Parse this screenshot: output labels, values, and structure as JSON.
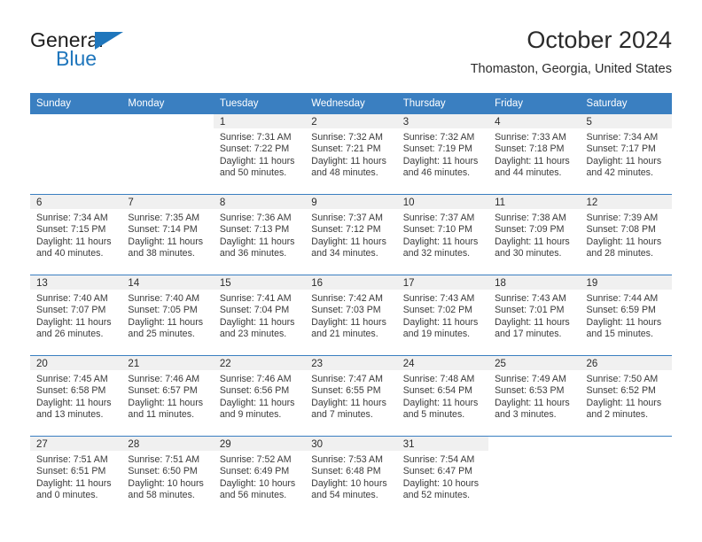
{
  "brand": {
    "name_part1": "General",
    "name_part2": "Blue",
    "accent_color": "#1f76bc"
  },
  "header": {
    "month_title": "October 2024",
    "location": "Thomaston, Georgia, United States"
  },
  "calendar": {
    "header_color": "#3a7fc1",
    "weekday_headers": [
      "Sunday",
      "Monday",
      "Tuesday",
      "Wednesday",
      "Thursday",
      "Friday",
      "Saturday"
    ],
    "weeks": [
      [
        {
          "day": "",
          "blank": true,
          "sunrise": "",
          "sunset": "",
          "daylight1": "",
          "daylight2": ""
        },
        {
          "day": "",
          "blank": true,
          "sunrise": "",
          "sunset": "",
          "daylight1": "",
          "daylight2": ""
        },
        {
          "day": "1",
          "sunrise": "Sunrise: 7:31 AM",
          "sunset": "Sunset: 7:22 PM",
          "daylight1": "Daylight: 11 hours",
          "daylight2": "and 50 minutes."
        },
        {
          "day": "2",
          "sunrise": "Sunrise: 7:32 AM",
          "sunset": "Sunset: 7:21 PM",
          "daylight1": "Daylight: 11 hours",
          "daylight2": "and 48 minutes."
        },
        {
          "day": "3",
          "sunrise": "Sunrise: 7:32 AM",
          "sunset": "Sunset: 7:19 PM",
          "daylight1": "Daylight: 11 hours",
          "daylight2": "and 46 minutes."
        },
        {
          "day": "4",
          "sunrise": "Sunrise: 7:33 AM",
          "sunset": "Sunset: 7:18 PM",
          "daylight1": "Daylight: 11 hours",
          "daylight2": "and 44 minutes."
        },
        {
          "day": "5",
          "sunrise": "Sunrise: 7:34 AM",
          "sunset": "Sunset: 7:17 PM",
          "daylight1": "Daylight: 11 hours",
          "daylight2": "and 42 minutes."
        }
      ],
      [
        {
          "day": "6",
          "sunrise": "Sunrise: 7:34 AM",
          "sunset": "Sunset: 7:15 PM",
          "daylight1": "Daylight: 11 hours",
          "daylight2": "and 40 minutes."
        },
        {
          "day": "7",
          "sunrise": "Sunrise: 7:35 AM",
          "sunset": "Sunset: 7:14 PM",
          "daylight1": "Daylight: 11 hours",
          "daylight2": "and 38 minutes."
        },
        {
          "day": "8",
          "sunrise": "Sunrise: 7:36 AM",
          "sunset": "Sunset: 7:13 PM",
          "daylight1": "Daylight: 11 hours",
          "daylight2": "and 36 minutes."
        },
        {
          "day": "9",
          "sunrise": "Sunrise: 7:37 AM",
          "sunset": "Sunset: 7:12 PM",
          "daylight1": "Daylight: 11 hours",
          "daylight2": "and 34 minutes."
        },
        {
          "day": "10",
          "sunrise": "Sunrise: 7:37 AM",
          "sunset": "Sunset: 7:10 PM",
          "daylight1": "Daylight: 11 hours",
          "daylight2": "and 32 minutes."
        },
        {
          "day": "11",
          "sunrise": "Sunrise: 7:38 AM",
          "sunset": "Sunset: 7:09 PM",
          "daylight1": "Daylight: 11 hours",
          "daylight2": "and 30 minutes."
        },
        {
          "day": "12",
          "sunrise": "Sunrise: 7:39 AM",
          "sunset": "Sunset: 7:08 PM",
          "daylight1": "Daylight: 11 hours",
          "daylight2": "and 28 minutes."
        }
      ],
      [
        {
          "day": "13",
          "sunrise": "Sunrise: 7:40 AM",
          "sunset": "Sunset: 7:07 PM",
          "daylight1": "Daylight: 11 hours",
          "daylight2": "and 26 minutes."
        },
        {
          "day": "14",
          "sunrise": "Sunrise: 7:40 AM",
          "sunset": "Sunset: 7:05 PM",
          "daylight1": "Daylight: 11 hours",
          "daylight2": "and 25 minutes."
        },
        {
          "day": "15",
          "sunrise": "Sunrise: 7:41 AM",
          "sunset": "Sunset: 7:04 PM",
          "daylight1": "Daylight: 11 hours",
          "daylight2": "and 23 minutes."
        },
        {
          "day": "16",
          "sunrise": "Sunrise: 7:42 AM",
          "sunset": "Sunset: 7:03 PM",
          "daylight1": "Daylight: 11 hours",
          "daylight2": "and 21 minutes."
        },
        {
          "day": "17",
          "sunrise": "Sunrise: 7:43 AM",
          "sunset": "Sunset: 7:02 PM",
          "daylight1": "Daylight: 11 hours",
          "daylight2": "and 19 minutes."
        },
        {
          "day": "18",
          "sunrise": "Sunrise: 7:43 AM",
          "sunset": "Sunset: 7:01 PM",
          "daylight1": "Daylight: 11 hours",
          "daylight2": "and 17 minutes."
        },
        {
          "day": "19",
          "sunrise": "Sunrise: 7:44 AM",
          "sunset": "Sunset: 6:59 PM",
          "daylight1": "Daylight: 11 hours",
          "daylight2": "and 15 minutes."
        }
      ],
      [
        {
          "day": "20",
          "sunrise": "Sunrise: 7:45 AM",
          "sunset": "Sunset: 6:58 PM",
          "daylight1": "Daylight: 11 hours",
          "daylight2": "and 13 minutes."
        },
        {
          "day": "21",
          "sunrise": "Sunrise: 7:46 AM",
          "sunset": "Sunset: 6:57 PM",
          "daylight1": "Daylight: 11 hours",
          "daylight2": "and 11 minutes."
        },
        {
          "day": "22",
          "sunrise": "Sunrise: 7:46 AM",
          "sunset": "Sunset: 6:56 PM",
          "daylight1": "Daylight: 11 hours",
          "daylight2": "and 9 minutes."
        },
        {
          "day": "23",
          "sunrise": "Sunrise: 7:47 AM",
          "sunset": "Sunset: 6:55 PM",
          "daylight1": "Daylight: 11 hours",
          "daylight2": "and 7 minutes."
        },
        {
          "day": "24",
          "sunrise": "Sunrise: 7:48 AM",
          "sunset": "Sunset: 6:54 PM",
          "daylight1": "Daylight: 11 hours",
          "daylight2": "and 5 minutes."
        },
        {
          "day": "25",
          "sunrise": "Sunrise: 7:49 AM",
          "sunset": "Sunset: 6:53 PM",
          "daylight1": "Daylight: 11 hours",
          "daylight2": "and 3 minutes."
        },
        {
          "day": "26",
          "sunrise": "Sunrise: 7:50 AM",
          "sunset": "Sunset: 6:52 PM",
          "daylight1": "Daylight: 11 hours",
          "daylight2": "and 2 minutes."
        }
      ],
      [
        {
          "day": "27",
          "sunrise": "Sunrise: 7:51 AM",
          "sunset": "Sunset: 6:51 PM",
          "daylight1": "Daylight: 11 hours",
          "daylight2": "and 0 minutes."
        },
        {
          "day": "28",
          "sunrise": "Sunrise: 7:51 AM",
          "sunset": "Sunset: 6:50 PM",
          "daylight1": "Daylight: 10 hours",
          "daylight2": "and 58 minutes."
        },
        {
          "day": "29",
          "sunrise": "Sunrise: 7:52 AM",
          "sunset": "Sunset: 6:49 PM",
          "daylight1": "Daylight: 10 hours",
          "daylight2": "and 56 minutes."
        },
        {
          "day": "30",
          "sunrise": "Sunrise: 7:53 AM",
          "sunset": "Sunset: 6:48 PM",
          "daylight1": "Daylight: 10 hours",
          "daylight2": "and 54 minutes."
        },
        {
          "day": "31",
          "sunrise": "Sunrise: 7:54 AM",
          "sunset": "Sunset: 6:47 PM",
          "daylight1": "Daylight: 10 hours",
          "daylight2": "and 52 minutes."
        },
        {
          "day": "",
          "blank": true,
          "sunrise": "",
          "sunset": "",
          "daylight1": "",
          "daylight2": ""
        },
        {
          "day": "",
          "blank": true,
          "sunrise": "",
          "sunset": "",
          "daylight1": "",
          "daylight2": ""
        }
      ]
    ]
  }
}
